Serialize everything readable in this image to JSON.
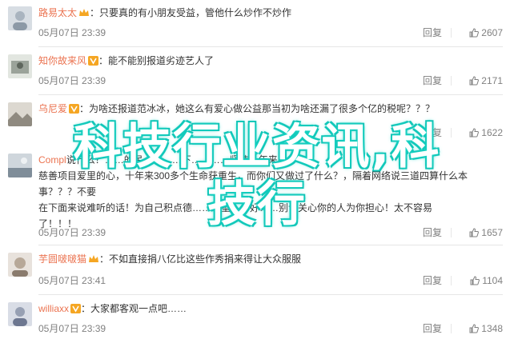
{
  "comments": [
    {
      "username": "路易太太",
      "badge": "crown-badge-icon",
      "text": "只要真的有小朋友受益，管他什么炒作不炒作",
      "timestamp": "05月07日 23:39",
      "reply_label": "回复",
      "likes": "2607"
    },
    {
      "username": "知你故来风",
      "badge": "v-badge-icon",
      "text": "能不能别报道劣迹艺人了",
      "timestamp": "05月07日 23:39",
      "reply_label": "回复",
      "likes": "2171"
    },
    {
      "username": "乌尼爱",
      "badge": "v-badge-icon",
      "text": "为啥还报道范冰冰，她这么有爱心做公益那当初为啥还漏了很多个亿的税呢？？？",
      "timestamp": "",
      "reply_label": "回复",
      "likes": "1622"
    },
    {
      "username": "Compl",
      "badge": "",
      "text_line1": "说什么？……的民…………下…………坚持十年来的",
      "text_line2": "慈善项目爱里的心，十年来300多个生命获重生，而你们又做过了什么？，隔着网络说三道四算什么本事？？？不要",
      "text_line3": "在下面来说难听的话！为自己积点德……希望……好……别让关心你的人为你担心！太不容易",
      "text_line4": "了！！！",
      "timestamp": "05月07日 23:39",
      "reply_label": "回复",
      "likes": "1657"
    },
    {
      "username": "芋圆啵啵猫",
      "badge": "crown-badge-icon",
      "text": "不如直接捐八亿比这些作秀捐来得让大众服服",
      "timestamp": "05月07日 23:41",
      "reply_label": "回复",
      "likes": "1104"
    },
    {
      "username": "williaxx",
      "badge": "v-badge-icon",
      "text": "大家都客观一点吧……",
      "timestamp": "05月07日 23:39",
      "reply_label": "回复",
      "likes": "1348"
    }
  ],
  "overlay": {
    "line1": "科技行业资讯,科",
    "line2": "技行"
  },
  "colors": {
    "username": "#eb7350",
    "meta": "#808080",
    "divider": "#e6e6e6",
    "overlay_glow": "#1ad6c6"
  }
}
